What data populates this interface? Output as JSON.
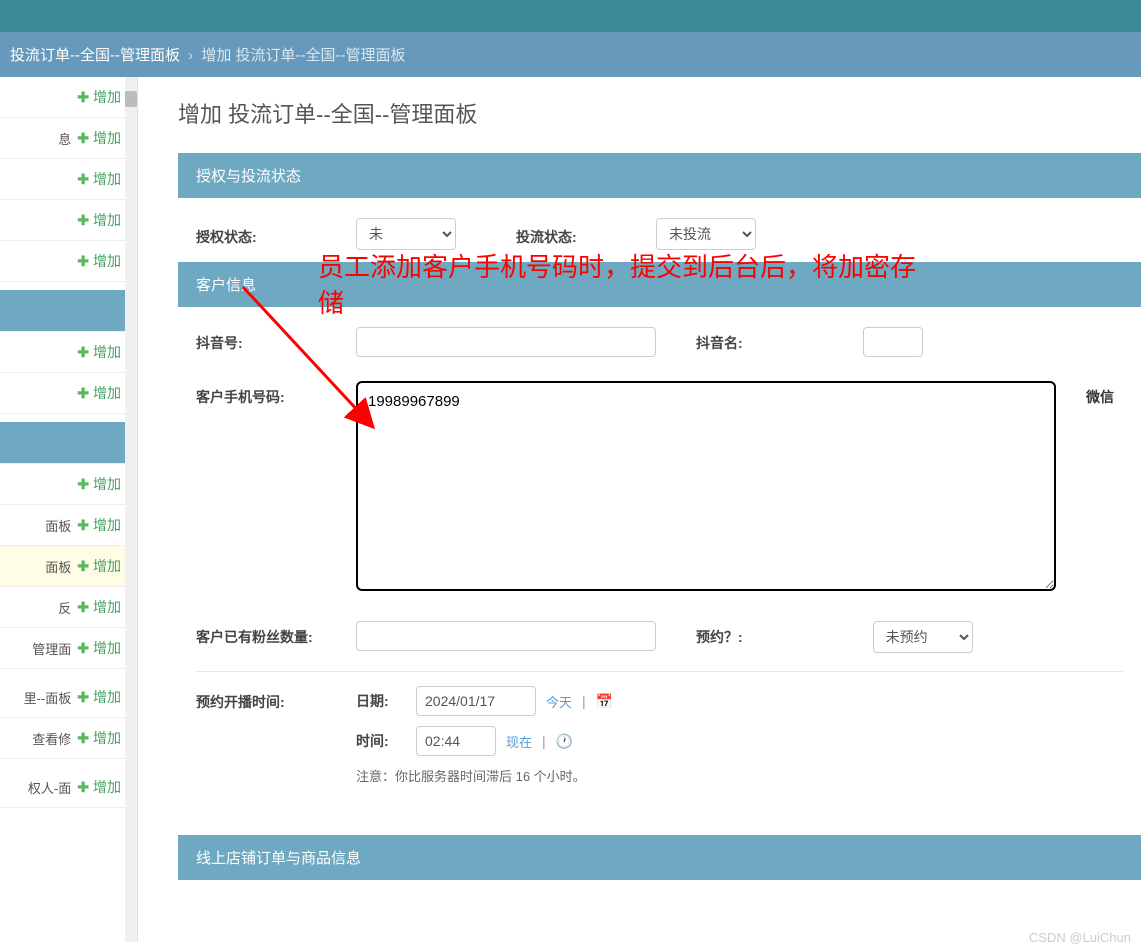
{
  "breadcrumb": {
    "main": "投流订单--全国--管理面板",
    "current": "增加 投流订单--全国--管理面板"
  },
  "page_title": "增加 投流订单--全国--管理面板",
  "sidebar": {
    "items": [
      {
        "label": "",
        "add": "增加",
        "type": "item"
      },
      {
        "label": "息",
        "add": "增加",
        "type": "item"
      },
      {
        "label": "",
        "add": "增加",
        "type": "item"
      },
      {
        "label": "",
        "add": "增加",
        "type": "item"
      },
      {
        "label": "",
        "add": "增加",
        "type": "item"
      },
      {
        "type": "spacer"
      },
      {
        "type": "header"
      },
      {
        "label": "",
        "add": "增加",
        "type": "item"
      },
      {
        "label": "",
        "add": "增加",
        "type": "item"
      },
      {
        "type": "spacer"
      },
      {
        "type": "header"
      },
      {
        "label": "",
        "add": "增加",
        "type": "item"
      },
      {
        "label": "面板",
        "add": "增加",
        "type": "item"
      },
      {
        "label": "面板",
        "add": "增加",
        "type": "item",
        "active": true
      },
      {
        "label": "反",
        "add": "增加",
        "type": "item"
      },
      {
        "label": "管理面",
        "add": "增加",
        "type": "item"
      },
      {
        "type": "spacer"
      },
      {
        "label": "里--面板",
        "add": "增加",
        "type": "item"
      },
      {
        "label": "查看修",
        "add": "增加",
        "type": "item"
      },
      {
        "type": "spacer"
      },
      {
        "label": "权人-面",
        "add": "增加",
        "type": "item"
      }
    ]
  },
  "sections": {
    "auth": {
      "title": "授权与投流状态",
      "auth_status_label": "授权状态:",
      "auth_status_value": "未",
      "flow_status_label": "投流状态:",
      "flow_status_value": "未投流"
    },
    "customer": {
      "title": "客户信息",
      "douyin_no_label": "抖音号:",
      "douyin_name_label": "抖音名:",
      "phone_label": "客户手机号码:",
      "phone_value": "19989967899",
      "wechat_label": "微信",
      "fans_label": "客户已有粉丝数量:",
      "reserve_label": "预约？:",
      "reserve_value": "未预约",
      "broadcast_time_label": "预约开播时间:",
      "date_label": "日期:",
      "date_value": "2024/01/17",
      "today_link": "今天",
      "time_label": "时间:",
      "time_value": "02:44",
      "now_link": "现在",
      "note": "注意：你比服务器时间滞后 16 个小时。"
    },
    "shop": {
      "title": "线上店铺订单与商品信息"
    }
  },
  "annotation_text": "员工添加客户手机号码时，提交到后台后，将加密存储",
  "watermark": "CSDN @LuiChun"
}
